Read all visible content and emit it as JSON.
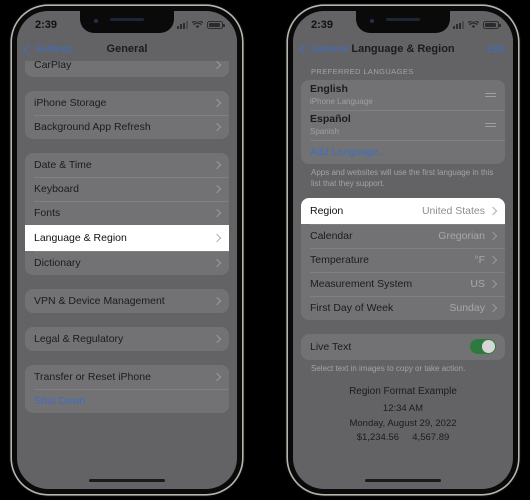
{
  "status_bar": {
    "time": "2:39",
    "signal_icon": "cellular-signal-icon",
    "wifi_icon": "wifi-icon",
    "battery_icon": "battery-icon"
  },
  "colors": {
    "accent_blue": "#3f6ec0",
    "toggle_green": "#2c7a3f",
    "highlight_white": "#ffffff",
    "screen_background": "#636366",
    "group_background": "#727275"
  },
  "left_phone": {
    "nav": {
      "back_label": "Settings",
      "title": "General",
      "back_icon": "chevron-left-icon"
    },
    "groups": [
      {
        "clipped": true,
        "rows": [
          {
            "label": "CarPlay",
            "type": "disclosure"
          }
        ]
      },
      {
        "rows": [
          {
            "label": "iPhone Storage",
            "type": "disclosure"
          },
          {
            "label": "Background App Refresh",
            "type": "disclosure"
          }
        ]
      },
      {
        "rows": [
          {
            "label": "Date & Time",
            "type": "disclosure"
          },
          {
            "label": "Keyboard",
            "type": "disclosure"
          },
          {
            "label": "Fonts",
            "type": "disclosure"
          },
          {
            "label": "Language & Region",
            "type": "disclosure",
            "highlight": true
          },
          {
            "label": "Dictionary",
            "type": "disclosure"
          }
        ]
      },
      {
        "rows": [
          {
            "label": "VPN & Device Management",
            "type": "disclosure"
          }
        ]
      },
      {
        "rows": [
          {
            "label": "Legal & Regulatory",
            "type": "disclosure"
          }
        ]
      },
      {
        "rows": [
          {
            "label": "Transfer or Reset iPhone",
            "type": "disclosure"
          },
          {
            "label": "Shut Down",
            "type": "link"
          }
        ]
      }
    ]
  },
  "right_phone": {
    "nav": {
      "back_label": "General",
      "title": "Language & Region",
      "edit_label": "Edit",
      "back_icon": "chevron-left-icon"
    },
    "preferred_languages": {
      "header": "PREFERRED LANGUAGES",
      "items": [
        {
          "name": "English",
          "detail": "iPhone Language",
          "reorder_icon": "reorder-handle-icon"
        },
        {
          "name": "Español",
          "detail": "Spanish",
          "reorder_icon": "reorder-handle-icon"
        }
      ],
      "add_language_label": "Add Language...",
      "footnote": "Apps and websites will use the first language in this list that they support."
    },
    "region_group": {
      "rows": [
        {
          "label": "Region",
          "value": "United States",
          "highlight": true
        },
        {
          "label": "Calendar",
          "value": "Gregorian"
        },
        {
          "label": "Temperature",
          "value": "°F"
        },
        {
          "label": "Measurement System",
          "value": "US"
        },
        {
          "label": "First Day of Week",
          "value": "Sunday"
        }
      ]
    },
    "live_text": {
      "label": "Live Text",
      "enabled": true,
      "footnote": "Select text in images to copy or take action."
    },
    "region_format_example": {
      "title": "Region Format Example",
      "time": "12:34 AM",
      "date": "Monday, August 29, 2022",
      "currency": "$1,234.56",
      "number": "4,567.89"
    }
  }
}
